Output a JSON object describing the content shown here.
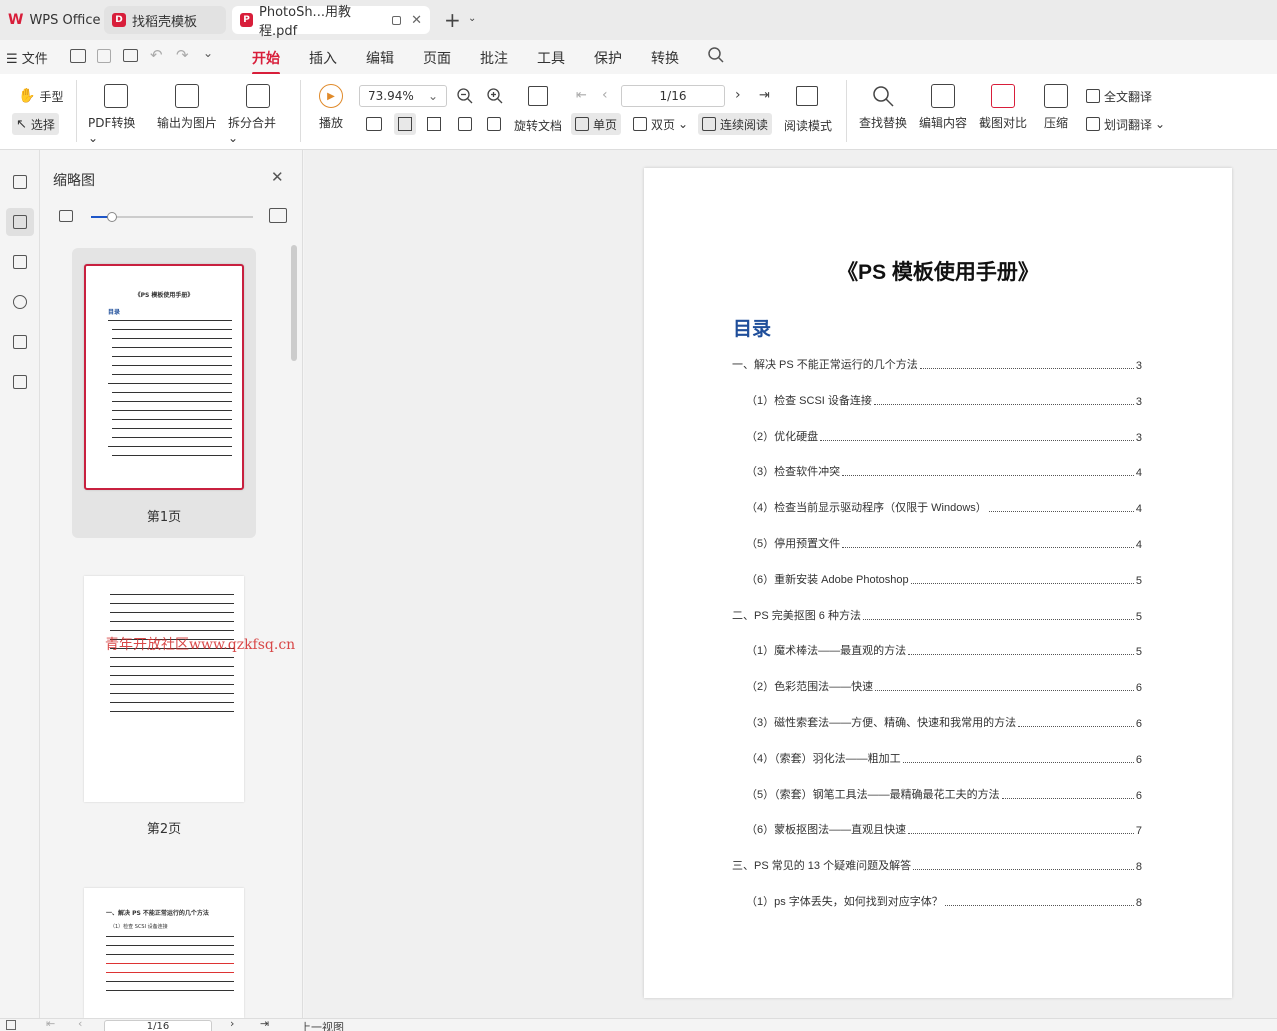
{
  "titlebar": {
    "app_tab": "WPS Office",
    "tab2": "找稻壳模板",
    "tab3": "PhotoSh...用教程.pdf",
    "new_tab": "+"
  },
  "menubar": {
    "file": "文件",
    "items": [
      "开始",
      "插入",
      "编辑",
      "页面",
      "批注",
      "工具",
      "保护",
      "转换"
    ]
  },
  "ribbon": {
    "hand": "手型",
    "select": "选择",
    "pdf_convert": "PDF转换",
    "export_image": "输出为图片",
    "split_merge": "拆分合并",
    "play": "播放",
    "zoom": "73.94%",
    "page_input": "1/16",
    "rotate": "旋转文档",
    "single": "单页",
    "double": "双页",
    "continuous": "连续阅读",
    "reading_mode": "阅读模式",
    "find_replace": "查找替换",
    "edit_content": "编辑内容",
    "screenshot_compare": "截图对比",
    "compress": "压缩",
    "full_translate": "全文翻译",
    "word_translate": "划词翻译"
  },
  "thumbpanel": {
    "title": "缩略图",
    "slider_percent": 13,
    "thumbs": [
      {
        "label": "第1页",
        "title": "《PS 模板使用手册》",
        "toc": "目录"
      },
      {
        "label": "第2页"
      },
      {
        "label": "",
        "heading": "一、解决 PS 不能正常运行的几个方法",
        "sub": "（1）检查 SCSI 设备连接"
      }
    ],
    "watermark": "青年开放社区www.qzkfsq.cn"
  },
  "document": {
    "title": "《PS 模板使用手册》",
    "toc_heading": "目录",
    "toc": [
      {
        "text": "一、解决 PS 不能正常运行的几个方法",
        "page": "3",
        "level": 1
      },
      {
        "text": "（1）检查  SCSI  设备连接",
        "page": "3",
        "level": 2
      },
      {
        "text": "（2）优化硬盘",
        "page": "3",
        "level": 2
      },
      {
        "text": "（3）检查软件冲突",
        "page": "4",
        "level": 2
      },
      {
        "text": "（4）检查当前显示驱动程序（仅限于 Windows）",
        "page": "4",
        "level": 2
      },
      {
        "text": "（5）停用预置文件",
        "page": "4",
        "level": 2
      },
      {
        "text": "（6）重新安装 Adobe Photoshop",
        "page": "5",
        "level": 2
      },
      {
        "text": "二、PS 完美抠图 6 种方法",
        "page": "5",
        "level": 1
      },
      {
        "text": "（1）魔术棒法——最直观的方法",
        "page": "5",
        "level": 2
      },
      {
        "text": "（2）色彩范围法——快速",
        "page": "6",
        "level": 2
      },
      {
        "text": "（3）磁性索套法——方便、精确、快速和我常用的方法",
        "page": "6",
        "level": 2
      },
      {
        "text": "（4）（索套）羽化法——粗加工",
        "page": "6",
        "level": 2
      },
      {
        "text": "（5）（索套）钢笔工具法——最精确最花工夫的方法",
        "page": "6",
        "level": 2
      },
      {
        "text": "（6）蒙板抠图法——直观且快速",
        "page": "7",
        "level": 2
      },
      {
        "text": "三、PS 常见的 13 个疑难问题及解答",
        "page": "8",
        "level": 1
      },
      {
        "text": "（1）ps 字体丢失，如何找到对应字体？",
        "page": "8",
        "level": 2
      }
    ]
  },
  "statusbar": {
    "page": "1/16",
    "prev_view": "上一视图"
  },
  "colors": {
    "accent": "#d81e3a",
    "toc_heading": "#1f4e9a"
  }
}
